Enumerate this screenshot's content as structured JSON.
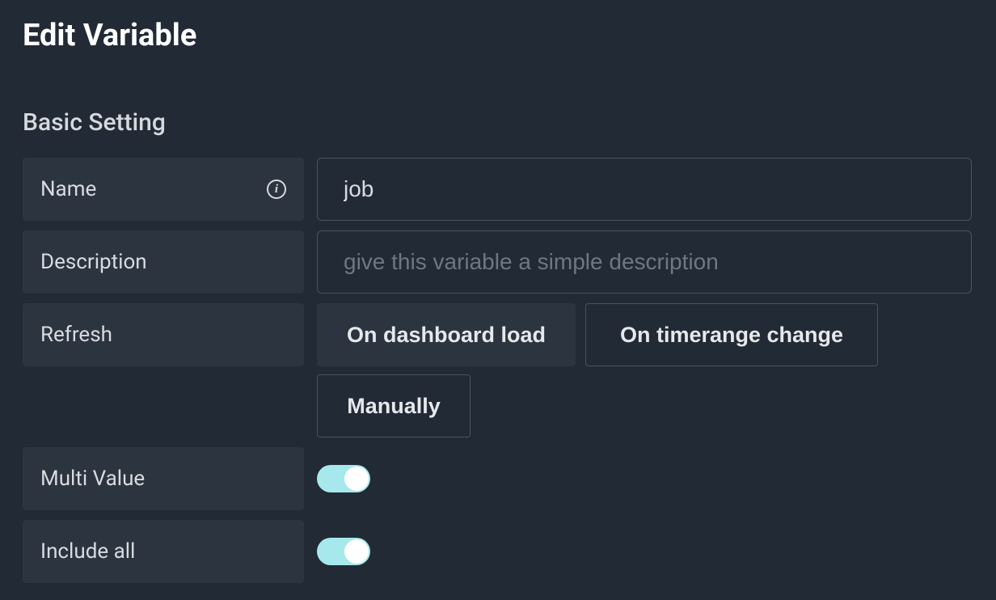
{
  "page": {
    "title": "Edit Variable"
  },
  "section": {
    "title": "Basic Setting"
  },
  "fields": {
    "name": {
      "label": "Name",
      "value": "job"
    },
    "description": {
      "label": "Description",
      "value": "",
      "placeholder": "give this variable a simple description"
    },
    "refresh": {
      "label": "Refresh",
      "options": {
        "on_dashboard_load": "On dashboard load",
        "on_timerange_change": "On timerange change",
        "manually": "Manually"
      },
      "selected": "on_dashboard_load"
    },
    "multi_value": {
      "label": "Multi Value",
      "on": true
    },
    "include_all": {
      "label": "Include all",
      "on": true
    }
  }
}
